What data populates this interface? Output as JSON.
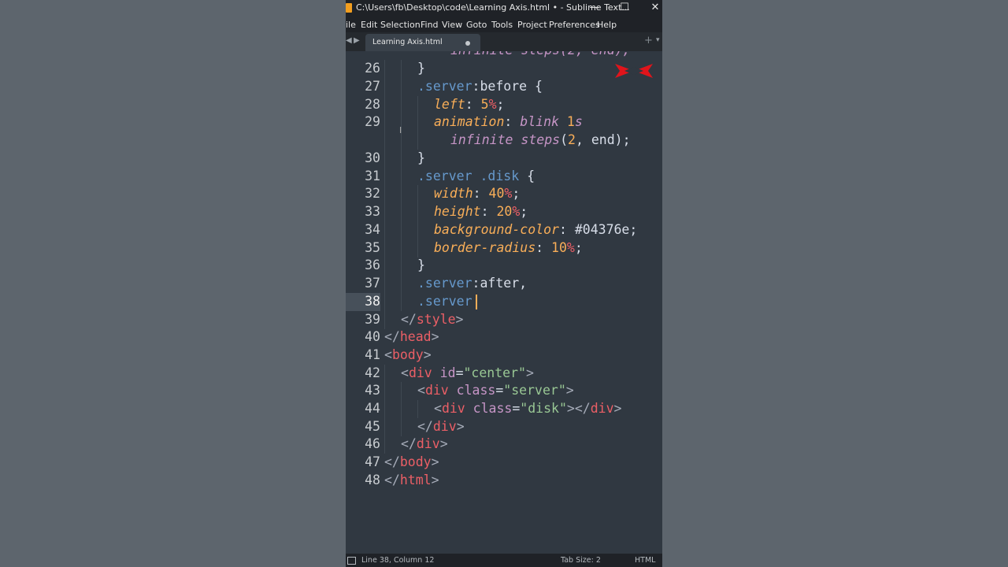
{
  "window": {
    "title": "C:\\Users\\fb\\Desktop\\code\\Learning Axis.html • - Sublime Text...",
    "min_glyph": "—",
    "max_glyph": "☐",
    "close_glyph": "✕"
  },
  "menu": [
    "ile",
    "Edit",
    "Selection",
    "Find",
    "View",
    "Goto",
    "Tools",
    "Project",
    "Preferences",
    "Help"
  ],
  "tabs": {
    "active_label": "Learning Axis.html",
    "add_glyph": "+",
    "more_glyph": "▾"
  },
  "editor": {
    "current_line": "38",
    "partial_top_text": "infinite steps(2, end);",
    "lines": [
      {
        "n": "26"
      },
      {
        "n": "27"
      },
      {
        "n": "28"
      },
      {
        "n": "29"
      },
      {
        "n": ""
      },
      {
        "n": "30"
      },
      {
        "n": "31"
      },
      {
        "n": "32"
      },
      {
        "n": "33"
      },
      {
        "n": "34"
      },
      {
        "n": "35"
      },
      {
        "n": "36"
      },
      {
        "n": "37"
      },
      {
        "n": "38"
      },
      {
        "n": "39"
      },
      {
        "n": "40"
      },
      {
        "n": "41"
      },
      {
        "n": "42"
      },
      {
        "n": "43"
      },
      {
        "n": "44"
      },
      {
        "n": "45"
      },
      {
        "n": "46"
      },
      {
        "n": "47"
      },
      {
        "n": "48"
      }
    ],
    "code": {
      "l26": "}",
      "l27a": ".server",
      "l27b": ":before",
      "l27c": " {",
      "l28a": "left",
      "l28b": ": ",
      "l28c": "5",
      "l28d": "%",
      "l28e": ";",
      "l29a": "animation",
      "l29b": ": ",
      "l29c": "blink",
      "l29d": " ",
      "l29e": "1",
      "l29f": "s",
      "l29w1": "infinite",
      "l29w2": " ",
      "l29w3": "steps",
      "l29w4": "(",
      "l29w5": "2",
      "l29w6": ", end);",
      "l30": "}",
      "l31a": ".server",
      "l31b": " ",
      "l31c": ".disk",
      "l31d": " {",
      "l32a": "width",
      "l32b": ": ",
      "l32c": "40",
      "l32d": "%",
      "l32e": ";",
      "l33a": "height",
      "l33b": ": ",
      "l33c": "20",
      "l33d": "%",
      "l33e": ";",
      "l34a": "background-color",
      "l34b": ": ",
      "l34c": "#04376e",
      "l34d": ";",
      "l35a": "border-radius",
      "l35b": ": ",
      "l35c": "10",
      "l35d": "%",
      "l35e": ";",
      "l36": "}",
      "l37a": ".server",
      "l37b": ":after",
      "l37c": ",",
      "l38a": ".server",
      "l39a": "</",
      "l39b": "style",
      "l39c": ">",
      "l40a": "</",
      "l40b": "head",
      "l40c": ">",
      "l41a": "<",
      "l41b": "body",
      "l41c": ">",
      "l42a": "<",
      "l42b": "div",
      "l42c": " id",
      "l42d": "=",
      "l42e": "\"center\"",
      "l42f": ">",
      "l43a": "<",
      "l43b": "div",
      "l43c": " class",
      "l43d": "=",
      "l43e": "\"server\"",
      "l43f": ">",
      "l44a": "<",
      "l44b": "div",
      "l44c": " class",
      "l44d": "=",
      "l44e": "\"disk\"",
      "l44f": "></",
      "l44g": "div",
      "l44h": ">",
      "l45a": "</",
      "l45b": "div",
      "l45c": ">",
      "l46a": "</",
      "l46b": "div",
      "l46c": ">",
      "l47a": "</",
      "l47b": "body",
      "l47c": ">",
      "l48a": "</",
      "l48b": "html",
      "l48c": ">"
    }
  },
  "statusbar": {
    "position": "Line 38, Column 12",
    "tab_size": "Tab Size: 2",
    "syntax": "HTML"
  },
  "colors": {
    "background": "#303841",
    "accent_caret": "#f9ae58",
    "tag": "#ec5f66",
    "string": "#99c794",
    "keyword": "#c695c6",
    "class": "#6699cc"
  },
  "icons": [
    "sublime-text-icon",
    "minimize-icon",
    "maximize-icon",
    "close-icon",
    "tab-left-arrow-icon",
    "tab-right-arrow-icon",
    "unsaved-dot-icon",
    "new-tab-icon",
    "tab-list-icon",
    "text-cursor-icon",
    "watermark-logo-icon",
    "panel-toggle-icon"
  ]
}
